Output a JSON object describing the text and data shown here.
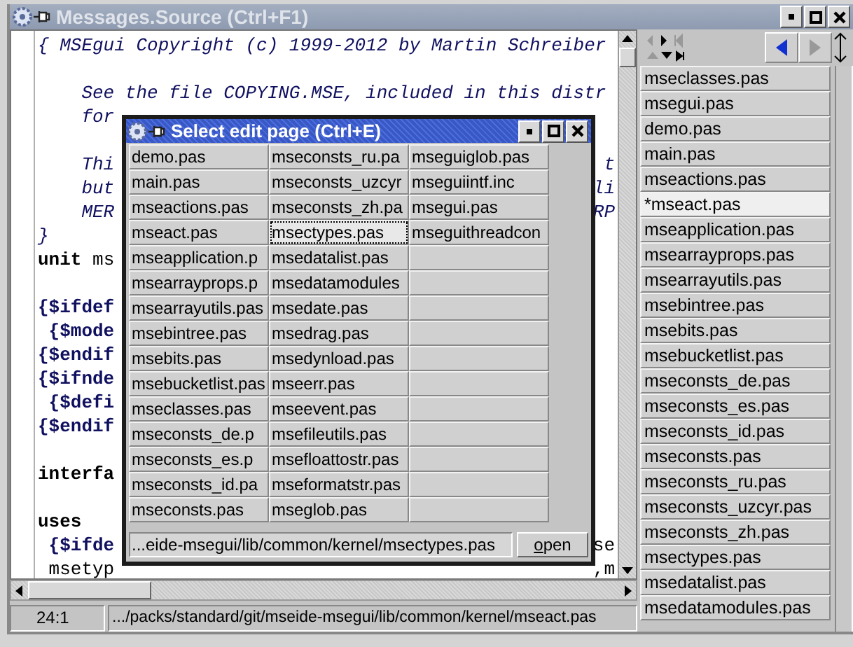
{
  "window": {
    "title": "Messages.Source (Ctrl+F1)"
  },
  "editor": {
    "lines": [
      {
        "kind": "comment",
        "text": "{ MSEgui Copyright (c) 1999-2012 by Martin Schreiber"
      },
      {
        "kind": "blank"
      },
      {
        "kind": "comment",
        "text": "    See the file COPYING.MSE, included in this distr"
      },
      {
        "kind": "comment",
        "text": "    for"
      },
      {
        "kind": "blank"
      },
      {
        "kind": "comment",
        "text": "    Thi",
        "right": {
          "kind": "comment",
          "text": "t"
        }
      },
      {
        "kind": "comment",
        "text": "    but",
        "right": {
          "kind": "comment",
          "text": "li"
        }
      },
      {
        "kind": "comment",
        "text": "    MER",
        "right": {
          "kind": "comment",
          "text": "RP"
        }
      },
      {
        "kind": "comment",
        "text": "}"
      },
      {
        "kind": "code",
        "text": "**unit** ms"
      },
      {
        "kind": "blank"
      },
      {
        "kind": "directive",
        "text": "{$ifdef"
      },
      {
        "kind": "directive",
        "text": " {$mode"
      },
      {
        "kind": "directive",
        "text": "{$endif"
      },
      {
        "kind": "directive",
        "text": "{$ifnde"
      },
      {
        "kind": "directive",
        "text": " {$defi"
      },
      {
        "kind": "directive",
        "text": "{$endif"
      },
      {
        "kind": "blank"
      },
      {
        "kind": "keyword",
        "text": "interfa"
      },
      {
        "kind": "blank"
      },
      {
        "kind": "keyword",
        "text": "uses"
      },
      {
        "kind": "directive",
        "text": " {$ifde",
        "right": {
          "kind": "code",
          "text": "se"
        }
      },
      {
        "kind": "code",
        "text": " msetyp",
        "right": {
          "kind": "code",
          "text": ",m"
        }
      }
    ]
  },
  "status_bar": {
    "position": "24:1",
    "path": ".../packs/standard/git/mseide-msegui/lib/common/kernel/mseact.pas"
  },
  "page_list": [
    {
      "label": "mseclasses.pas",
      "selected": false
    },
    {
      "label": "msegui.pas",
      "selected": false
    },
    {
      "label": "demo.pas",
      "selected": false
    },
    {
      "label": "main.pas",
      "selected": false
    },
    {
      "label": "mseactions.pas",
      "selected": false
    },
    {
      "label": "*mseact.pas",
      "selected": true
    },
    {
      "label": "mseapplication.pas",
      "selected": false
    },
    {
      "label": "msearrayprops.pas",
      "selected": false
    },
    {
      "label": "msearrayutils.pas",
      "selected": false
    },
    {
      "label": "msebintree.pas",
      "selected": false
    },
    {
      "label": "msebits.pas",
      "selected": false
    },
    {
      "label": "msebucketlist.pas",
      "selected": false
    },
    {
      "label": "mseconsts_de.pas",
      "selected": false
    },
    {
      "label": "mseconsts_es.pas",
      "selected": false
    },
    {
      "label": "mseconsts_id.pas",
      "selected": false
    },
    {
      "label": "mseconsts.pas",
      "selected": false
    },
    {
      "label": "mseconsts_ru.pas",
      "selected": false
    },
    {
      "label": "mseconsts_uzcyr.pas",
      "selected": false
    },
    {
      "label": "mseconsts_zh.pas",
      "selected": false
    },
    {
      "label": "msectypes.pas",
      "selected": false
    },
    {
      "label": "msedatalist.pas",
      "selected": false
    },
    {
      "label": "msedatamodules.pas",
      "selected": false
    }
  ],
  "dialog": {
    "title": "Select edit page (Ctrl+E)",
    "columns": [
      [
        {
          "text": "demo.pas",
          "selected": false
        },
        {
          "text": "main.pas",
          "selected": false
        },
        {
          "text": "mseactions.pas",
          "selected": false
        },
        {
          "text": "mseact.pas",
          "selected": false
        },
        {
          "text": "mseapplication.p",
          "selected": false
        },
        {
          "text": "msearrayprops.p",
          "selected": false
        },
        {
          "text": "msearrayutils.pas",
          "selected": false
        },
        {
          "text": "msebintree.pas",
          "selected": false
        },
        {
          "text": "msebits.pas",
          "selected": false
        },
        {
          "text": "msebucketlist.pas",
          "selected": false
        },
        {
          "text": "mseclasses.pas",
          "selected": false
        },
        {
          "text": "mseconsts_de.p",
          "selected": false
        },
        {
          "text": "mseconsts_es.p",
          "selected": false
        },
        {
          "text": "mseconsts_id.pa",
          "selected": false
        },
        {
          "text": "mseconsts.pas",
          "selected": false
        }
      ],
      [
        {
          "text": "mseconsts_ru.pa",
          "selected": false
        },
        {
          "text": "mseconsts_uzcyr",
          "selected": false
        },
        {
          "text": "mseconsts_zh.pa",
          "selected": false
        },
        {
          "text": "msectypes.pas",
          "selected": true
        },
        {
          "text": "msedatalist.pas",
          "selected": false
        },
        {
          "text": "msedatamodules",
          "selected": false
        },
        {
          "text": "msedate.pas",
          "selected": false
        },
        {
          "text": "msedrag.pas",
          "selected": false
        },
        {
          "text": "msedynload.pas",
          "selected": false
        },
        {
          "text": "mseerr.pas",
          "selected": false
        },
        {
          "text": "mseevent.pas",
          "selected": false
        },
        {
          "text": "msefileutils.pas",
          "selected": false
        },
        {
          "text": "msefloattostr.pas",
          "selected": false
        },
        {
          "text": "mseformatstr.pas",
          "selected": false
        },
        {
          "text": "mseglob.pas",
          "selected": false
        }
      ],
      [
        {
          "text": "mseguiglob.pas",
          "selected": false
        },
        {
          "text": "mseguiintf.inc",
          "selected": false
        },
        {
          "text": "msegui.pas",
          "selected": false
        },
        {
          "text": "mseguithreadcon",
          "selected": false
        }
      ]
    ],
    "path_field": {
      "value": "...eide-msegui/lib/common/kernel/msectypes.pas"
    },
    "open_button": {
      "label": "open"
    }
  }
}
